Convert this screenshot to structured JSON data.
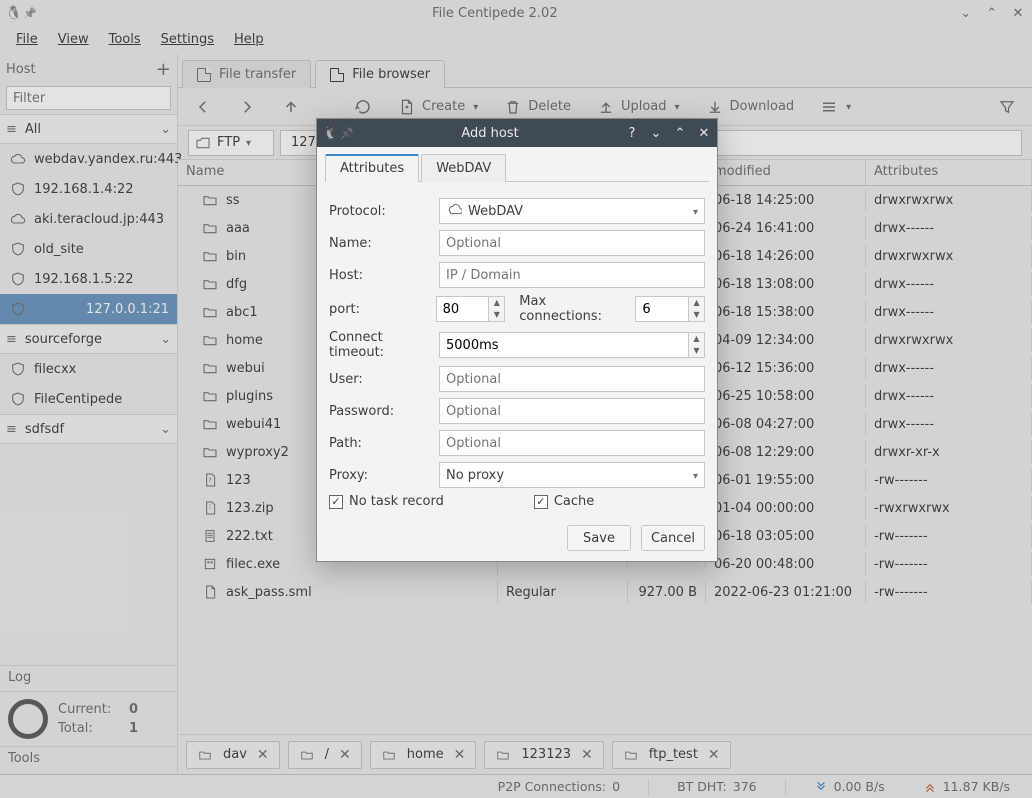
{
  "window": {
    "title": "File Centipede 2.02"
  },
  "menu": [
    "File",
    "View",
    "Tools",
    "Settings",
    "Help"
  ],
  "host_panel": {
    "title": "Host",
    "filter_placeholder": "Filter",
    "groups": [
      {
        "label": "All",
        "kind": "group",
        "expanded": true
      },
      {
        "label": "webdav.yandex.ru:443",
        "kind": "host",
        "icon": "cloud"
      },
      {
        "label": "192.168.1.4:22",
        "kind": "host",
        "icon": "shield"
      },
      {
        "label": "aki.teracloud.jp:443",
        "kind": "host",
        "icon": "cloud"
      },
      {
        "label": "old_site",
        "kind": "host",
        "icon": "shield"
      },
      {
        "label": "192.168.1.5:22",
        "kind": "host",
        "icon": "shield"
      },
      {
        "label": "127.0.0.1:21",
        "kind": "host",
        "icon": "shield",
        "selected": true
      },
      {
        "label": "sourceforge",
        "kind": "group",
        "expanded": true
      },
      {
        "label": "filecxx",
        "kind": "host",
        "icon": "shield"
      },
      {
        "label": "FileCentipede",
        "kind": "host",
        "icon": "shield"
      },
      {
        "label": "sdfsdf",
        "kind": "group",
        "expanded": true
      }
    ],
    "log_label": "Log",
    "current_label": "Current:",
    "current_value": "0",
    "total_label": "Total:",
    "total_value": "1",
    "tools_label": "Tools"
  },
  "tabs": [
    {
      "label": "File transfer",
      "active": false
    },
    {
      "label": "File browser",
      "active": true
    }
  ],
  "toolbar": {
    "create": "Create",
    "delete": "Delete",
    "upload": "Upload",
    "download": "Download"
  },
  "address": {
    "protocol": "FTP",
    "crumb": "127"
  },
  "table": {
    "headers": [
      "Name",
      "",
      "",
      "modified",
      "Attributes"
    ],
    "rows": [
      {
        "name": "ss",
        "icon": "folder",
        "type": "",
        "size": "",
        "mod": "06-18 14:25:00",
        "attr": "drwxrwxrwx"
      },
      {
        "name": "aaa",
        "icon": "folder",
        "type": "",
        "size": "",
        "mod": "06-24 16:41:00",
        "attr": "drwx------"
      },
      {
        "name": "bin",
        "icon": "folder",
        "type": "",
        "size": "",
        "mod": "06-18 14:26:00",
        "attr": "drwxrwxrwx"
      },
      {
        "name": "dfg",
        "icon": "folder",
        "type": "",
        "size": "",
        "mod": "06-18 13:08:00",
        "attr": "drwx------"
      },
      {
        "name": "abc1",
        "icon": "folder",
        "type": "",
        "size": "",
        "mod": "06-18 15:38:00",
        "attr": "drwx------"
      },
      {
        "name": "home",
        "icon": "folder",
        "type": "",
        "size": "",
        "mod": "04-09 12:34:00",
        "attr": "drwxrwxrwx"
      },
      {
        "name": "webui",
        "icon": "folder",
        "type": "",
        "size": "",
        "mod": "06-12 15:36:00",
        "attr": "drwx------"
      },
      {
        "name": "plugins",
        "icon": "folder",
        "type": "",
        "size": "",
        "mod": "06-25 10:58:00",
        "attr": "drwx------"
      },
      {
        "name": "webui41",
        "icon": "folder",
        "type": "",
        "size": "",
        "mod": "06-08 04:27:00",
        "attr": "drwx------"
      },
      {
        "name": "wyproxy2",
        "icon": "folder",
        "type": "",
        "size": "",
        "mod": "06-08 12:29:00",
        "attr": "drwxr-xr-x"
      },
      {
        "name": "123",
        "icon": "unknown",
        "type": "",
        "size": "",
        "mod": "06-01 19:55:00",
        "attr": "-rw-------"
      },
      {
        "name": "123.zip",
        "icon": "archive",
        "type": "",
        "size": "",
        "mod": "01-04 00:00:00",
        "attr": "-rwxrwxrwx"
      },
      {
        "name": "222.txt",
        "icon": "text",
        "type": "",
        "size": "",
        "mod": "06-18 03:05:00",
        "attr": "-rw-------"
      },
      {
        "name": "filec.exe",
        "icon": "exe",
        "type": "",
        "size": "",
        "mod": "06-20 00:48:00",
        "attr": "-rw-------"
      },
      {
        "name": "ask_pass.sml",
        "icon": "file",
        "type": "Regular",
        "size": "927.00 B",
        "mod": "2022-06-23 01:21:00",
        "attr": "-rw-------"
      }
    ]
  },
  "path_tabs": [
    "dav",
    "/",
    "home",
    "123123",
    "ftp_test"
  ],
  "statusbar": {
    "p2p_label": "P2P Connections:",
    "p2p_value": "0",
    "dht_label": "BT DHT:",
    "dht_value": "376",
    "down": "0.00 B/s",
    "up": "11.87 KB/s"
  },
  "modal": {
    "title": "Add host",
    "tabs": [
      "Attributes",
      "WebDAV"
    ],
    "fields": {
      "protocol_label": "Protocol:",
      "protocol_value": "WebDAV",
      "name_label": "Name:",
      "name_placeholder": "Optional",
      "host_label": "Host:",
      "host_placeholder": "IP / Domain",
      "port_label": "port:",
      "port_value": "80",
      "maxcon_label": "Max connections:",
      "maxcon_value": "6",
      "timeout_label": "Connect timeout:",
      "timeout_value": "5000ms",
      "user_label": "User:",
      "user_placeholder": "Optional",
      "password_label": "Password:",
      "password_placeholder": "Optional",
      "path_label": "Path:",
      "path_placeholder": "Optional",
      "proxy_label": "Proxy:",
      "proxy_value": "No proxy",
      "no_task": "No task record",
      "cache": "Cache"
    },
    "save": "Save",
    "cancel": "Cancel"
  }
}
